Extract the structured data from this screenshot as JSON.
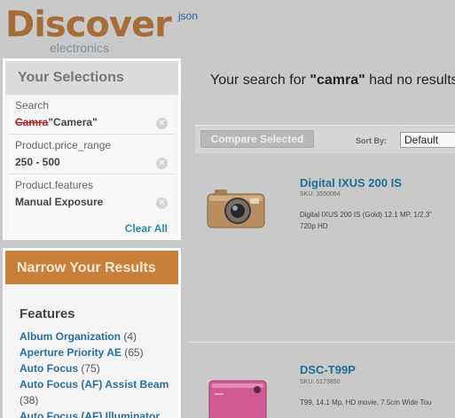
{
  "brand": {
    "name": "Discover",
    "sub": "electronics"
  },
  "json_link": "json",
  "selections": {
    "title": "Your Selections",
    "facets": [
      {
        "label": "Search",
        "struck": "Camra",
        "value": "\"Camera\""
      },
      {
        "label": "Product.price_range",
        "value": "250 - 500"
      },
      {
        "label": "Product.features",
        "value": "Manual Exposure"
      }
    ],
    "clear_all": "Clear All"
  },
  "narrow": {
    "title": "Narrow Your Results",
    "features_title": "Features",
    "items": [
      {
        "name": "Album Organization",
        "count": "(4)"
      },
      {
        "name": "Aperture Priority AE",
        "count": "(65)"
      },
      {
        "name": "Auto Focus",
        "count": "(75)"
      },
      {
        "name": "Auto Focus (AF) Assist Beam",
        "count": "(38)"
      },
      {
        "name": "Auto Focus (AF) Illuminator",
        "count": ""
      }
    ]
  },
  "search_message": {
    "prefix": "Your search for ",
    "term": "\"camra\"",
    "suffix": " had no results"
  },
  "toolbar": {
    "compare_label": "Compare Selected",
    "sort_label": "Sort By:",
    "sort_value": "Default"
  },
  "results": [
    {
      "title": "Digital IXUS 200 IS",
      "sku": "SKU: 3550064",
      "desc1": "Digital IXUS 200 IS (Gold) 12.1 MP, 1/2.3\"",
      "desc2": "720p HD"
    },
    {
      "title": "DSC-T99P",
      "sku": "SKU: 6173850",
      "desc1": "T99, 14.1 Mp, HD movie, 7.5cm Wide Tou",
      "desc2": ""
    }
  ],
  "colors": {
    "brand": "#a66d38",
    "link": "#2a6fa3",
    "narrow_header": "#c77f3a"
  }
}
